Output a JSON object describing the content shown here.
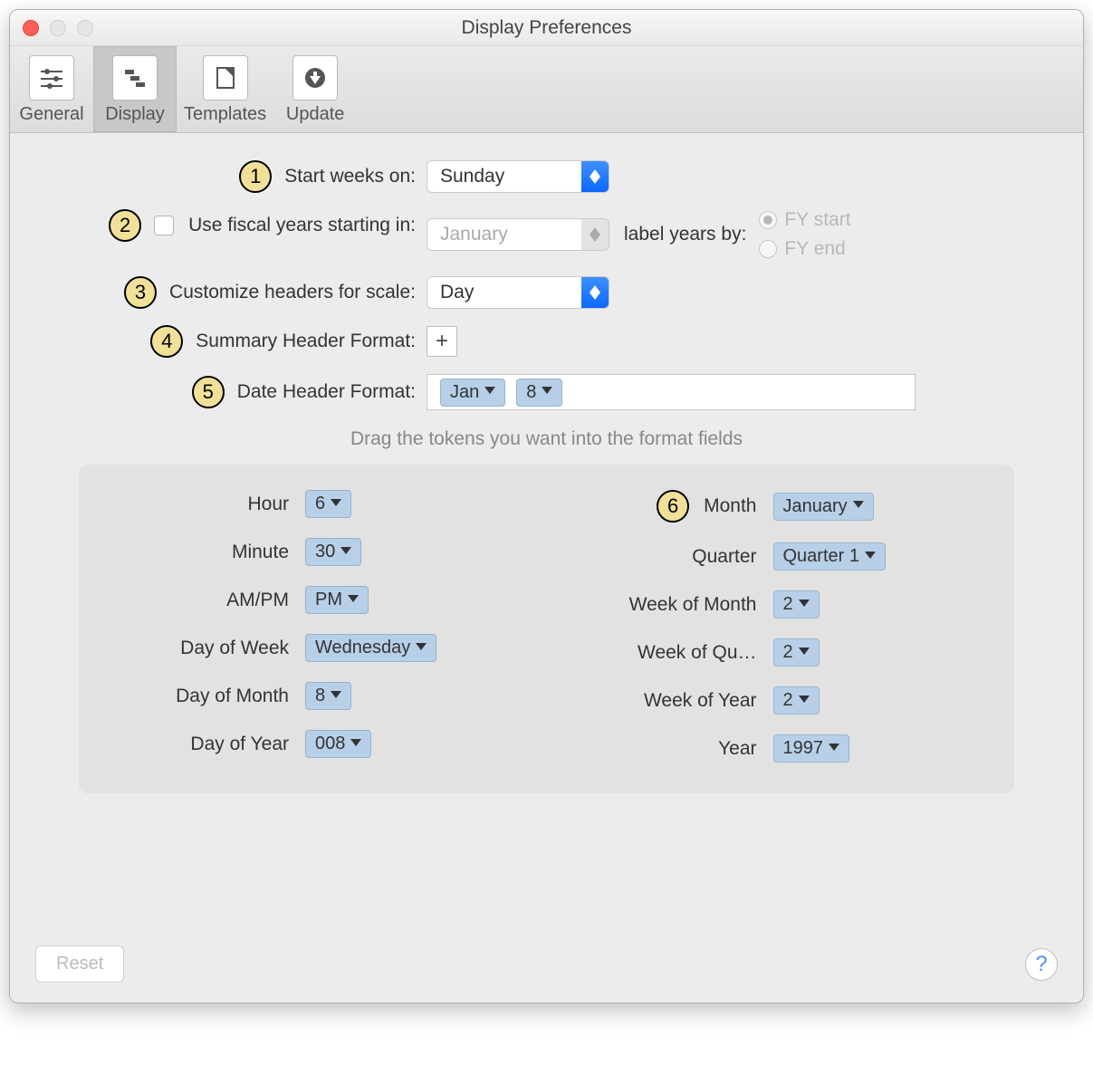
{
  "window": {
    "title": "Display Preferences"
  },
  "toolbar": {
    "items": [
      {
        "label": "General",
        "icon": "sliders-icon"
      },
      {
        "label": "Display",
        "icon": "steps-icon"
      },
      {
        "label": "Templates",
        "icon": "template-icon"
      },
      {
        "label": "Update",
        "icon": "download-icon"
      }
    ],
    "selected_index": 1
  },
  "callouts": {
    "c1": "1",
    "c2": "2",
    "c3": "3",
    "c4": "4",
    "c5": "5",
    "c6": "6"
  },
  "form": {
    "start_weeks_on_label": "Start weeks on:",
    "start_weeks_on_value": "Sunday",
    "use_fiscal_label": "Use fiscal years starting in:",
    "fiscal_month_value": "January",
    "label_years_by": "label years by:",
    "fy_start": "FY start",
    "fy_end": "FY end",
    "customize_label": "Customize headers for scale:",
    "customize_value": "Day",
    "summary_label": "Summary Header Format:",
    "date_header_label": "Date Header Format:",
    "date_tokens": {
      "month": "Jan",
      "day": "8"
    }
  },
  "hint": "Drag the tokens you want into the format fields",
  "palette": {
    "left": [
      {
        "label": "Hour",
        "value": "6"
      },
      {
        "label": "Minute",
        "value": "30"
      },
      {
        "label": "AM/PM",
        "value": "PM"
      },
      {
        "label": "Day of Week",
        "value": "Wednesday"
      },
      {
        "label": "Day of Month",
        "value": "8"
      },
      {
        "label": "Day of Year",
        "value": "008"
      }
    ],
    "right": [
      {
        "label": "Month",
        "value": "January"
      },
      {
        "label": "Quarter",
        "value": "Quarter 1"
      },
      {
        "label": "Week of Month",
        "value": "2"
      },
      {
        "label": "Week of Qu…",
        "value": "2"
      },
      {
        "label": "Week of Year",
        "value": "2"
      },
      {
        "label": "Year",
        "value": "1997"
      }
    ]
  },
  "footer": {
    "reset": "Reset",
    "help": "?"
  }
}
